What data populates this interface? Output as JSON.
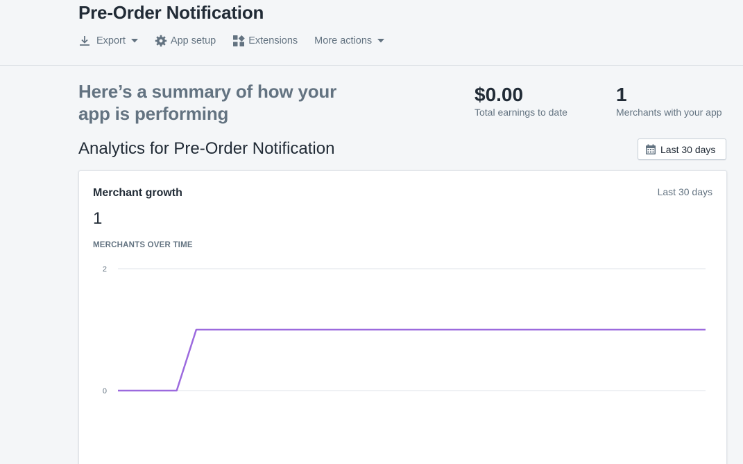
{
  "header": {
    "title": "Pre-Order Notification",
    "actions": [
      {
        "label": "Export",
        "icon": "download-icon",
        "dropdown": true
      },
      {
        "label": "App setup",
        "icon": "gear-icon",
        "dropdown": false
      },
      {
        "label": "Extensions",
        "icon": "extensions-icon",
        "dropdown": false
      },
      {
        "label": "More actions",
        "icon": "",
        "dropdown": true
      }
    ]
  },
  "summary": {
    "heading": "Here’s a summary of how your app is performing",
    "earnings": {
      "value": "$0.00",
      "label": "Total earnings to date"
    },
    "merchants": {
      "value": "1",
      "label": "Merchants with your app"
    }
  },
  "analytics": {
    "heading": "Analytics for Pre-Order Notification",
    "range_button": {
      "label": "Last 30 days",
      "icon": "calendar-icon"
    }
  },
  "card": {
    "title": "Merchant growth",
    "range": "Last 30 days",
    "value": "1",
    "subtitle": "MERCHANTS OVER TIME"
  },
  "colors": {
    "line": "#9c6ade",
    "text_subdued": "#637381",
    "gridline": "#dfe3e8"
  },
  "chart_data": {
    "type": "line",
    "title": "",
    "xlabel": "",
    "ylabel": "",
    "ylim": [
      0,
      2
    ],
    "y_ticks": [
      0,
      2
    ],
    "x": [
      0,
      3,
      4,
      30
    ],
    "values": [
      0,
      0,
      1,
      1
    ],
    "xlim": [
      0,
      30
    ],
    "grid": true
  }
}
